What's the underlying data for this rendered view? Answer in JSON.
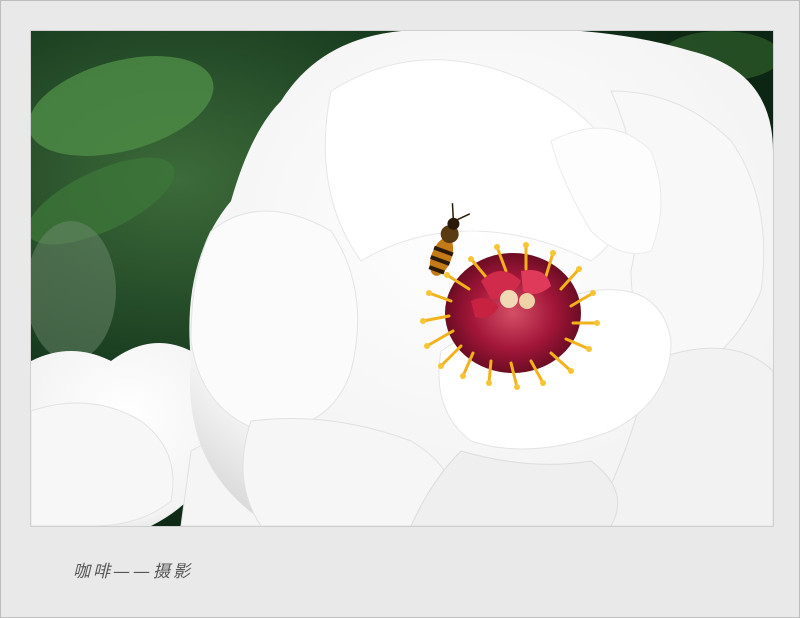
{
  "photo": {
    "subject": "peony-with-bee",
    "colors": {
      "background_dark": "#14361c",
      "leaf": "#3f7a3a",
      "petal": "#ffffff",
      "petal_shadow": "#dcdcdc",
      "center": "#8c0d2a",
      "stamen": "#f2b21c",
      "bee": "#2b1a08"
    }
  },
  "caption": {
    "signature": "咖啡——摄影"
  }
}
